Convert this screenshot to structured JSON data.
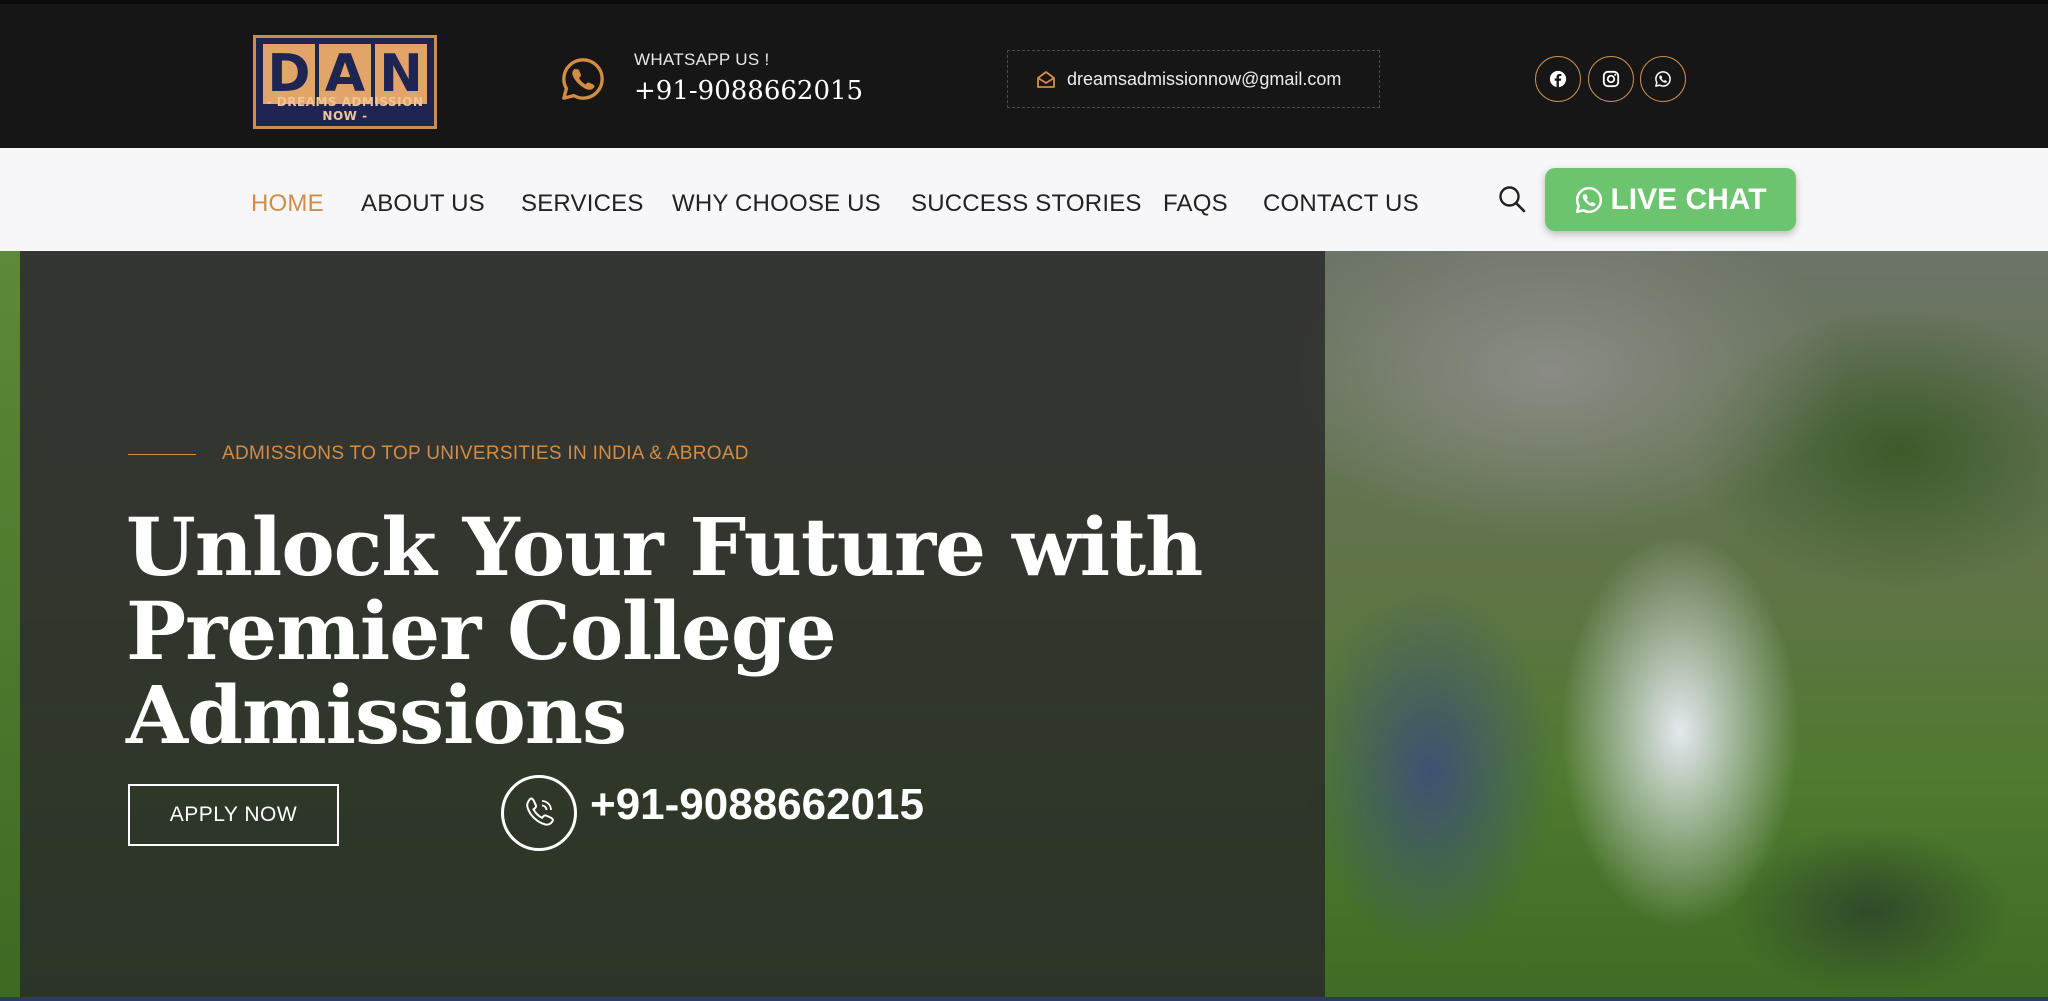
{
  "topbar": {
    "logo": {
      "letters": [
        "D",
        "A",
        "N"
      ],
      "subtitle": "- DREAMS ADMISSION NOW -"
    },
    "whatsapp": {
      "label": "WHATSAPP US !",
      "number": "+91-9088662015"
    },
    "email": "dreamsadmissionnow@gmail.com",
    "social": [
      "facebook-icon",
      "instagram-icon",
      "whatsapp-icon"
    ]
  },
  "nav": {
    "items": [
      "HOME",
      "ABOUT US",
      "SERVICES",
      "WHY CHOOSE US",
      "SUCCESS STORIES",
      "FAQS",
      "CONTACT US"
    ],
    "active": "HOME",
    "live_chat": "LIVE CHAT"
  },
  "hero": {
    "tagline": "ADMISSIONS TO TOP UNIVERSITIES IN INDIA & ABROAD",
    "title_line1": "Unlock Your Future with",
    "title_line2": "Premier College Admissions",
    "apply_label": "APPLY NOW",
    "phone": "+91-9088662015"
  },
  "colors": {
    "accent": "#d28c45",
    "topbar_bg": "#161616",
    "nav_bg": "#f7f7f9",
    "live_chat_bg": "#6dc46f",
    "logo_navy": "#1f2552",
    "logo_orange": "#e2a469"
  }
}
